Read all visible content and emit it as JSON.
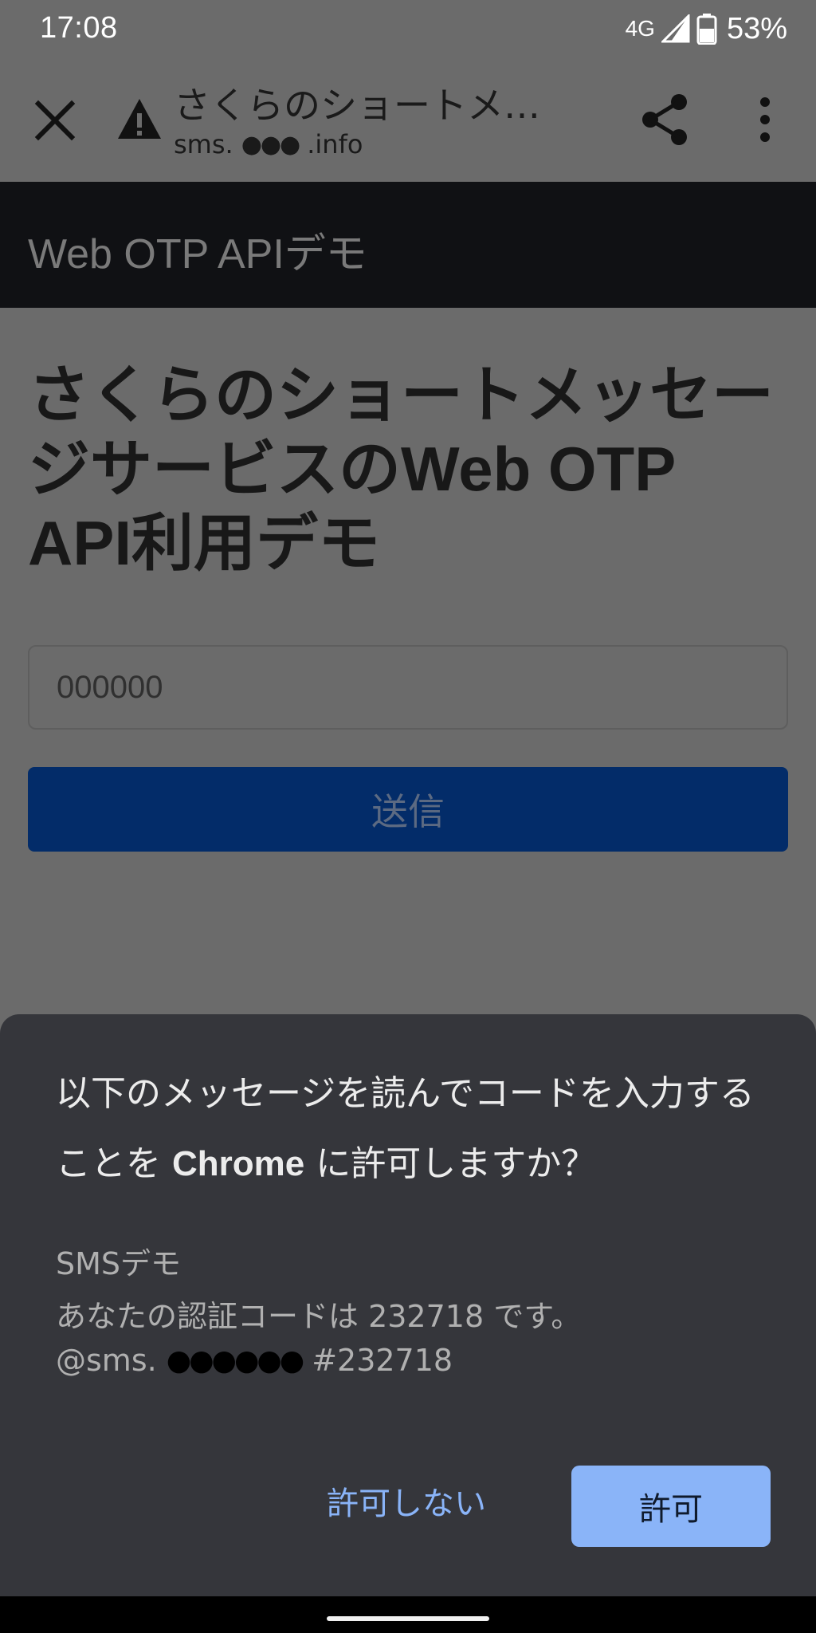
{
  "status_bar": {
    "time": "17:08",
    "network": "4G",
    "battery": "53%"
  },
  "toolbar": {
    "title": "さくらのショートメッセージサービスのWeb OTP API利用デモ",
    "url_prefix": "sms.",
    "url_masked": "●●●",
    "url_suffix": ".info",
    "icons": [
      "close-icon",
      "warning-icon",
      "share-icon",
      "more-vert-icon"
    ]
  },
  "page": {
    "header_title": "Web OTP APIデモ",
    "heading_part1": "さくらのショートメッセージサービスの",
    "heading_part2": "Web OTP API",
    "heading_part3": "利用デモ",
    "input_placeholder": "000000",
    "submit_label": "送信"
  },
  "dialog": {
    "question_part1": "以下のメッセージを読んでコードを入力することを ",
    "question_app": "Chrome",
    "question_part2": " に許可しますか？",
    "sender": "SMSデモ",
    "message_body": "あなたの認証コードは 232718 です。",
    "origin_prefix": "@sms.",
    "origin_masked": "●●●●●●",
    "origin_code": "#232718",
    "deny_label": "許可しない",
    "allow_label": "許可"
  },
  "colors": {
    "page_background": "#6b6b6b",
    "header_background": "#101114",
    "submit_background": "#032c69",
    "sheet_background": "#35363b",
    "accent": "#8ab4f8"
  }
}
